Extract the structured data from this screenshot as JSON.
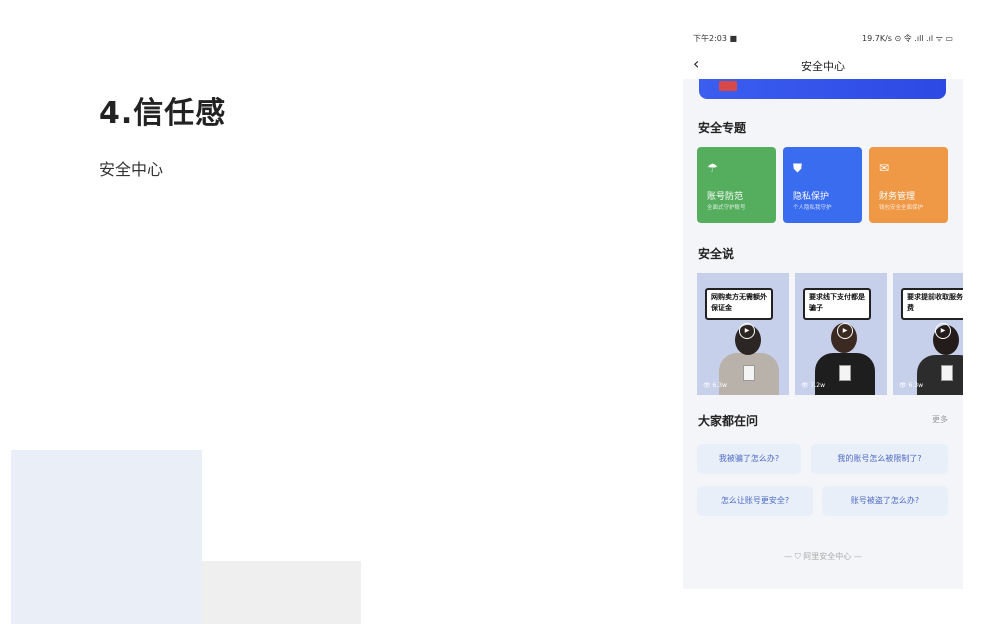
{
  "slide": {
    "title": "4.信任感",
    "subtitle": "安全中心"
  },
  "phone": {
    "status": {
      "time": "下午2:03 ■",
      "right": "19.7K/s ⊙ 令 .ıll .ıl ᯤ ▭"
    },
    "nav": {
      "back": "‹",
      "title": "安全中心"
    },
    "banner": {
      "text": ""
    },
    "topics": {
      "title": "安全专题",
      "cards": [
        {
          "title": "账号防范",
          "desc": "全面式守护账号",
          "icon": "☂",
          "icon_name": "umbrella-icon",
          "color": "#55ad5e"
        },
        {
          "title": "隐私保护",
          "desc": "个人隐私我守护",
          "icon": "⛊",
          "icon_name": "shield-icon",
          "color": "#3a6cf0"
        },
        {
          "title": "财务管理",
          "desc": "钱包安全全面保护",
          "icon": "✉",
          "icon_name": "bag-icon",
          "color": "#ef9845"
        }
      ]
    },
    "talks": {
      "title": "安全说",
      "videos": [
        {
          "caption": "网购卖方无需额外保证金",
          "views": "6.3w"
        },
        {
          "caption": "要求线下支付都是骗子",
          "views": "7.2w"
        },
        {
          "caption": "要求提前收取服务费",
          "views": "6.3w"
        }
      ]
    },
    "faq": {
      "title": "大家都在问",
      "more": "更多",
      "questions": [
        "我被骗了怎么办?",
        "我的账号怎么被限制了?",
        "怎么让账号更安全?",
        "账号被盗了怎么办?"
      ]
    },
    "footer": "— ⛉ 阿里安全中心 —"
  }
}
